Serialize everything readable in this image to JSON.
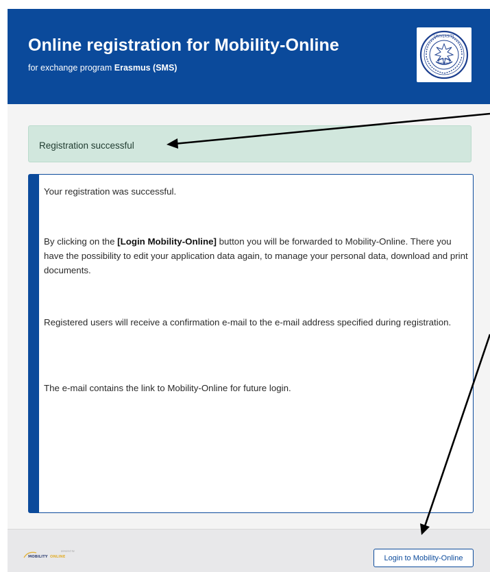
{
  "header": {
    "title": "Online registration for Mobility-Online",
    "subtitle_prefix": "for exchange program ",
    "program": "Erasmus (SMS)",
    "seal_text": "UNIVERSITY"
  },
  "alert": {
    "message": "Registration successful"
  },
  "info": {
    "p1": "Your registration was successful.",
    "p2_before": "By clicking on the ",
    "p2_bold": "[Login Mobility-Online]",
    "p2_after": " button you will be forwarded to Mobility-Online. There you have the possibility to edit your application data again, to manage your personal data, download and print documents.",
    "p3": "Registered users will receive a confirmation e-mail to the e-mail address specified during registration.",
    "p4": "The e-mail contains the link to Mobility-Online for future login."
  },
  "footer": {
    "powered_by": "powered by",
    "brand_left": "MOBILITY",
    "brand_right": "ONLINE",
    "login_button": "Login to Mobility-Online"
  },
  "colors": {
    "brand_blue": "#0b4a9b",
    "success_bg": "#d1e7dd",
    "annotation_arrow": "#000000"
  }
}
